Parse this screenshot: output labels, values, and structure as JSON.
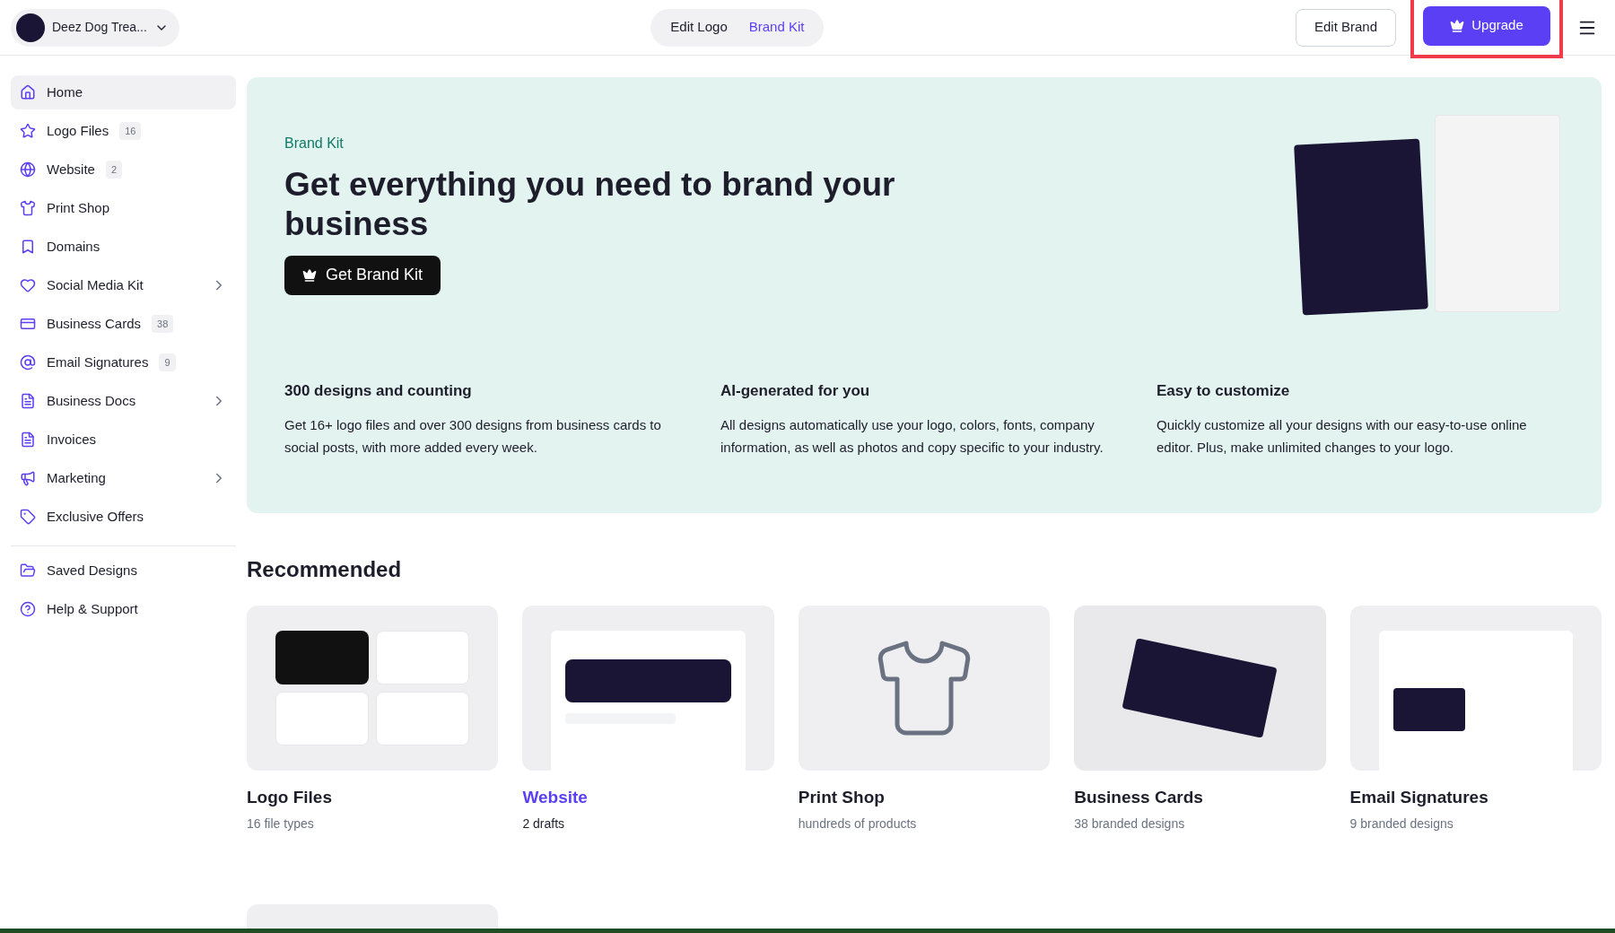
{
  "header": {
    "brand": {
      "name": "Deez Dog Trea..."
    },
    "mode_tabs": [
      {
        "label": "Edit Logo",
        "selected": false
      },
      {
        "label": "Brand Kit",
        "selected": true
      }
    ],
    "edit_button": "Edit Brand",
    "upgrade_button": {
      "label": "Upgrade",
      "highlighted": true
    }
  },
  "sidebar": {
    "items": [
      {
        "label": "Home",
        "selected": true
      },
      {
        "label": "Logo Files",
        "count": "16",
        "selected": false
      },
      {
        "label": "Website",
        "count": "2",
        "selected": false
      },
      {
        "label": "Print Shop",
        "selected": false
      },
      {
        "label": "Domains",
        "selected": false
      },
      {
        "label": "Social Media Kit",
        "submenu": true,
        "selected": false
      },
      {
        "label": "Business Cards",
        "count": "38",
        "selected": false
      },
      {
        "label": "Email Signatures",
        "count": "9",
        "selected": false
      },
      {
        "label": "Business Docs",
        "submenu": true,
        "selected": false
      },
      {
        "label": "Invoices",
        "selected": false
      },
      {
        "label": "Marketing",
        "submenu": true,
        "selected": false
      },
      {
        "label": "Exclusive Offers",
        "selected": false
      }
    ],
    "footer_items": [
      {
        "label": "Saved Designs"
      },
      {
        "label": "Help & Support"
      }
    ]
  },
  "hero": {
    "eyebrow": "Brand Kit",
    "title": "Get everything you need to brand your business",
    "button": "Get Brand Kit",
    "features": [
      {
        "title": "300 designs and counting",
        "body": "Get 16+ logo files and over 300 designs from business cards to social posts, with more added every week."
      },
      {
        "title": "AI-generated for you",
        "body": "All designs automatically use your logo, colors, fonts, company information, as well as photos and copy specific to your industry."
      },
      {
        "title": "Easy to customize",
        "body": "Quickly customize all your designs with our easy-to-use online editor. Plus, make unlimited changes to your logo."
      }
    ]
  },
  "recommended": {
    "heading": "Recommended",
    "cards": [
      {
        "title": "Logo Files",
        "subtitle": "16 file types",
        "active": false
      },
      {
        "title": "Website",
        "subtitle": "2 drafts",
        "active": true
      },
      {
        "title": "Print Shop",
        "subtitle": "hundreds of products",
        "active": false
      },
      {
        "title": "Business Cards",
        "subtitle": "38 branded designs",
        "active": false
      },
      {
        "title": "Email Signatures",
        "subtitle": "9 branded designs",
        "active": false
      }
    ]
  }
}
